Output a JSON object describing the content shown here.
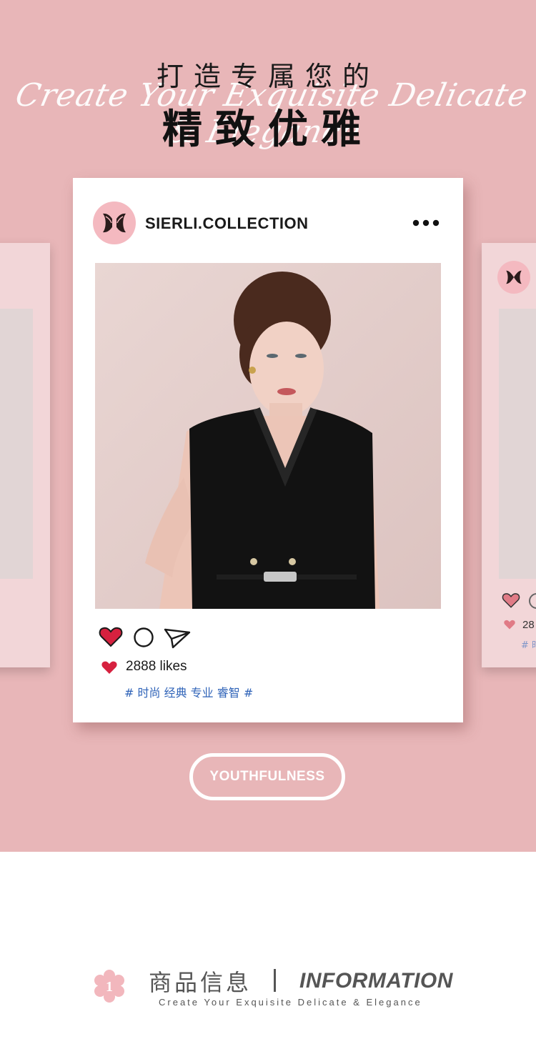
{
  "hero": {
    "title_line1": "打造专属您的",
    "script_text": "Create Your Exquisite Delicate & Elegance",
    "title_line2": "精致优雅",
    "background_color": "#e8b6b8"
  },
  "post": {
    "account_name": "SIERLI.COLLECTION",
    "more_icon": "more-dots-icon",
    "photo": "model-black-dress-photo",
    "actions": [
      "heart-icon",
      "comment-icon",
      "share-icon"
    ],
    "likes": "2888 likes",
    "tags": "# 时尚 经典 专业 睿智 #"
  },
  "side_card_right": {
    "likes": "28",
    "tags": "# 时"
  },
  "badge": {
    "label": "YOUTHFULNESS"
  },
  "section": {
    "number": "1",
    "title_zh": "商品信息",
    "title_en": "INFORMATION",
    "subtitle": "Create Your Exquisite Delicate & Elegance"
  },
  "colors": {
    "accent_pink": "#e8b6b8",
    "heart_red": "#d6213f",
    "tag_blue": "#2f63b8"
  }
}
